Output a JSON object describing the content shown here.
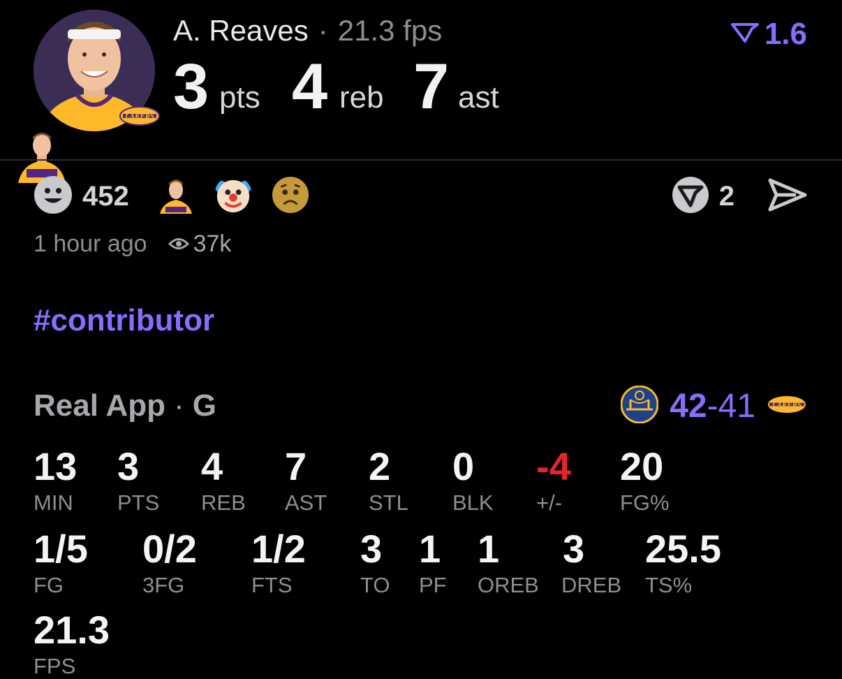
{
  "header": {
    "player_name": "A. Reaves",
    "separator": "·",
    "fps_text": "21.3 fps",
    "rating": "1.6",
    "big_stats": [
      {
        "value": "3",
        "unit": "pts"
      },
      {
        "value": "4",
        "unit": "reb"
      },
      {
        "value": "7",
        "unit": "ast"
      }
    ]
  },
  "reactions": {
    "count": "452",
    "emojis": [
      "player-face",
      "clown-emoji",
      "worried-emoji"
    ],
    "comments_count": "2"
  },
  "meta": {
    "time": "1 hour ago",
    "views": "37k"
  },
  "hashtag": "#contributor",
  "game": {
    "league": "Real App",
    "separator": "·",
    "position": "G",
    "score_home": "42",
    "score_dash": "-",
    "score_away": "41"
  },
  "stats_row1": [
    {
      "value": "13",
      "label": "MIN"
    },
    {
      "value": "3",
      "label": "PTS"
    },
    {
      "value": "4",
      "label": "REB"
    },
    {
      "value": "7",
      "label": "AST"
    },
    {
      "value": "2",
      "label": "STL"
    },
    {
      "value": "0",
      "label": "BLK"
    },
    {
      "value": "-4",
      "label": "+/-"
    },
    {
      "value": "20",
      "label": "FG%"
    }
  ],
  "stats_row2": [
    {
      "value": "1/5",
      "label": "FG"
    },
    {
      "value": "0/2",
      "label": "3FG"
    },
    {
      "value": "1/2",
      "label": "FTS"
    },
    {
      "value": "3",
      "label": "TO"
    },
    {
      "value": "1",
      "label": "PF"
    },
    {
      "value": "1",
      "label": "OREB"
    },
    {
      "value": "3",
      "label": "DREB"
    },
    {
      "value": "25.5",
      "label": "TS%"
    }
  ],
  "stats_row3": [
    {
      "value": "21.3",
      "label": "FPS"
    }
  ],
  "colors": {
    "accent": "#8b6cff",
    "negative": "#e5242d",
    "muted": "#8e8e93",
    "lakers_gold": "#fdb927",
    "lakers_purple": "#552583",
    "warriors_blue": "#1d428a"
  }
}
